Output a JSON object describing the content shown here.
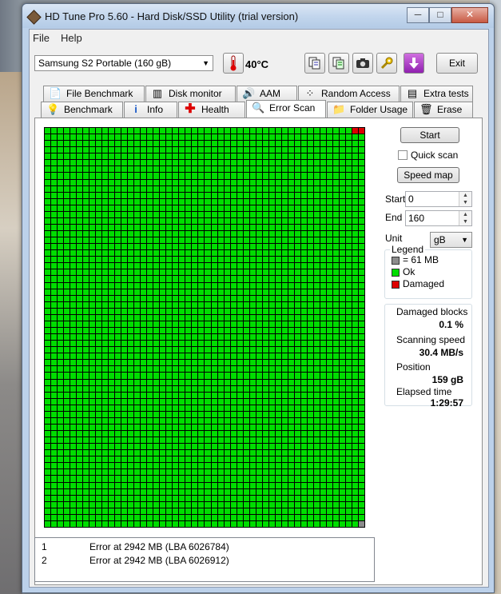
{
  "window": {
    "title": "HD Tune Pro 5.60 - Hard Disk/SSD Utility (trial version)",
    "controls": {
      "minimize": "─",
      "maximize": "□",
      "close": "✕"
    }
  },
  "menu": {
    "file": "File",
    "help": "Help"
  },
  "toolbar": {
    "drive": "Samsung S2 Portable (160 gB)",
    "temperature": "40°C",
    "exit_label": "Exit"
  },
  "tabs_top": [
    {
      "label": "File Benchmark",
      "icon": "file-benchmark-icon"
    },
    {
      "label": "Disk monitor",
      "icon": "disk-monitor-icon"
    },
    {
      "label": "AAM",
      "icon": "speaker-icon"
    },
    {
      "label": "Random Access",
      "icon": "random-access-icon"
    },
    {
      "label": "Extra tests",
      "icon": "extra-tests-icon"
    }
  ],
  "tabs_bottom": [
    {
      "label": "Benchmark",
      "icon": "lightbulb-icon"
    },
    {
      "label": "Info",
      "icon": "info-icon"
    },
    {
      "label": "Health",
      "icon": "health-cross-icon"
    },
    {
      "label": "Error Scan",
      "icon": "magnifier-icon",
      "active": true
    },
    {
      "label": "Folder Usage",
      "icon": "folder-icon"
    },
    {
      "label": "Erase",
      "icon": "trash-icon"
    }
  ],
  "scan": {
    "start_button": "Start",
    "quick_scan_label": "Quick scan",
    "quick_scan_checked": false,
    "speed_map_button": "Speed map",
    "start_label": "Start",
    "start_value": "0",
    "end_label": "End",
    "end_value": "160",
    "unit_label": "Unit",
    "unit_value": "gB"
  },
  "legend": {
    "title": "Legend",
    "block_size": "= 61 MB",
    "ok": "Ok",
    "damaged": "Damaged",
    "colors": {
      "block": "#8c8c8c",
      "ok": "#00dd00",
      "damaged": "#dd0000"
    }
  },
  "stats": {
    "damaged_blocks_label": "Damaged blocks",
    "damaged_blocks_value": "0.1 %",
    "scanning_speed_label": "Scanning speed",
    "scanning_speed_value": "30.4 MB/s",
    "position_label": "Position",
    "position_value": "159 gB",
    "elapsed_label": "Elapsed time",
    "elapsed_value": "1:29:57"
  },
  "errors": [
    {
      "num": "1",
      "text": "Error at 2942 MB (LBA 6026784)"
    },
    {
      "num": "2",
      "text": "Error at 2942 MB (LBA 6026912)"
    }
  ]
}
